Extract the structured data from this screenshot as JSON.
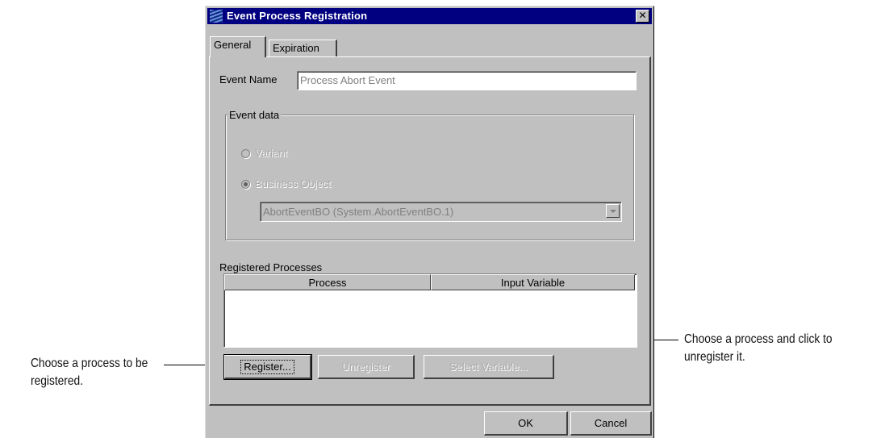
{
  "window": {
    "title": "Event Process Registration",
    "close_glyph": "✕"
  },
  "tabs": [
    {
      "label": "General",
      "selected": true
    },
    {
      "label": "Expiration",
      "selected": false
    }
  ],
  "event_name": {
    "label": "Event Name",
    "value": "Process Abort Event"
  },
  "event_data": {
    "legend": "Event data",
    "options": [
      {
        "label": "Variant",
        "selected": false
      },
      {
        "label": "Business Object",
        "selected": true
      }
    ],
    "combo_value": "AbortEventBO  (System.AbortEventBO.1)"
  },
  "registered_processes": {
    "label": "Registered Processes",
    "columns": [
      "Process",
      "Input Variable"
    ],
    "rows": []
  },
  "actions": {
    "register": "Register...",
    "unregister": "Unregister",
    "select_variable": "Select Variable..."
  },
  "footer": {
    "ok": "OK",
    "cancel": "Cancel"
  },
  "annotations": {
    "left": {
      "line1": "Choose a process to be",
      "line2": "registered."
    },
    "right": {
      "line1": "Choose a process and click to",
      "line2": "unregister it."
    }
  },
  "colors": {
    "titlebar": "#000080",
    "face": "#c0c0c0",
    "disabled_text": "#808080"
  }
}
